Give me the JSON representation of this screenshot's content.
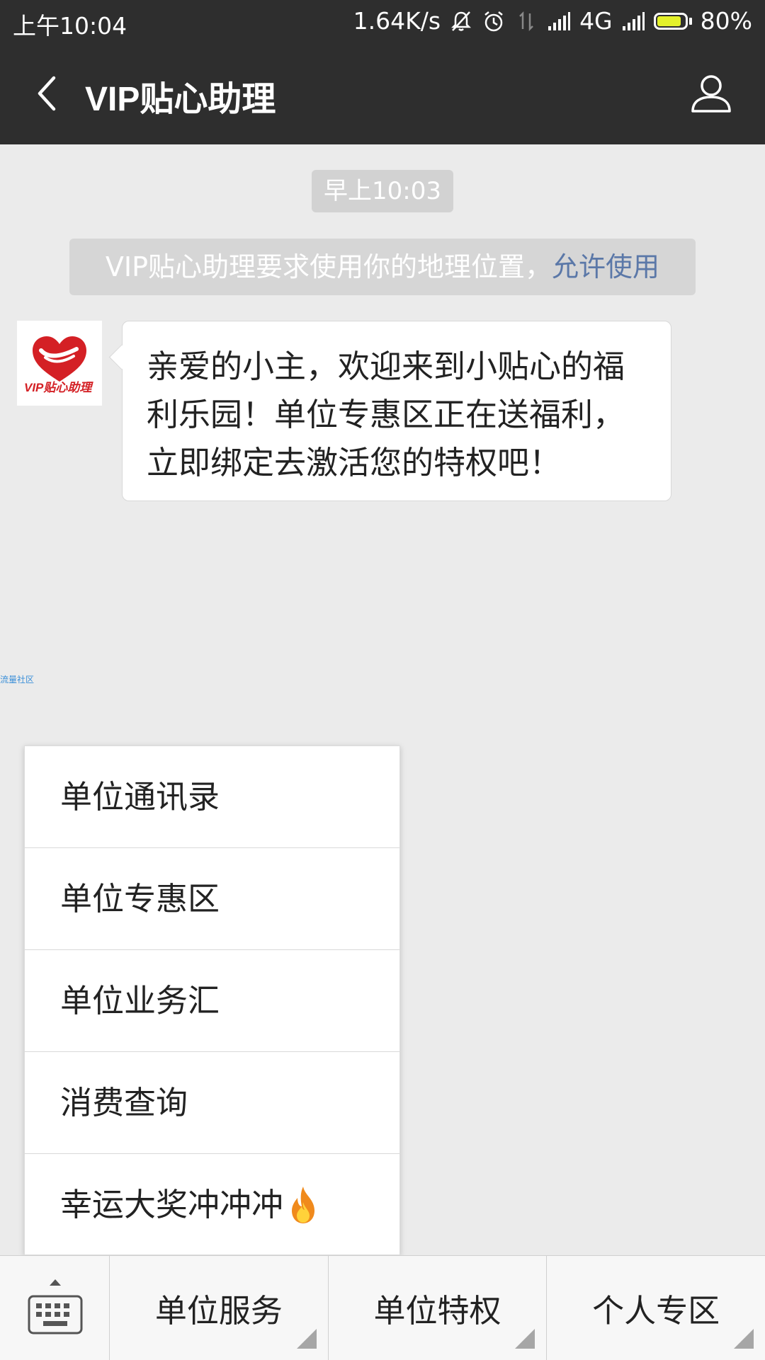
{
  "status_bar": {
    "time": "上午10:04",
    "network_speed": "1.64K/s",
    "network_type": "4G",
    "battery": "80%",
    "battery_level": 0.8,
    "icons": [
      "mute-bell-icon",
      "alarm-icon",
      "data-transfer-icon",
      "signal-icon",
      "signal-icon-2",
      "battery-icon"
    ]
  },
  "header": {
    "title": "VIP贴心助理",
    "back_icon": "chevron-left-icon",
    "profile_icon": "person-icon"
  },
  "chat": {
    "timestamp": "早上10:03",
    "system_notice": {
      "text": "VIP贴心助理要求使用你的地理位置，",
      "link": "允许使用"
    },
    "message": {
      "avatar_text": "VIP贴心助理",
      "text": "亲爱的小主，欢迎来到小贴心的福利乐园！单位专惠区正在送福利，立即绑定去激活您的特权吧！"
    },
    "side_link": "流量社区"
  },
  "popup_menu": {
    "items": [
      {
        "label": "单位通讯录"
      },
      {
        "label": "单位专惠区"
      },
      {
        "label": "单位业务汇"
      },
      {
        "label": "消费查询"
      },
      {
        "label": "幸运大奖冲冲冲"
      }
    ]
  },
  "bottom_bar": {
    "keyboard_icon": "keyboard-icon",
    "tabs": [
      {
        "label": "单位服务"
      },
      {
        "label": "单位特权"
      },
      {
        "label": "个人专区"
      }
    ]
  },
  "colors": {
    "header_bg": "#2e2e2e",
    "chat_bg": "#ebebeb",
    "link": "#5b78a8",
    "brand_red": "#d42025"
  }
}
